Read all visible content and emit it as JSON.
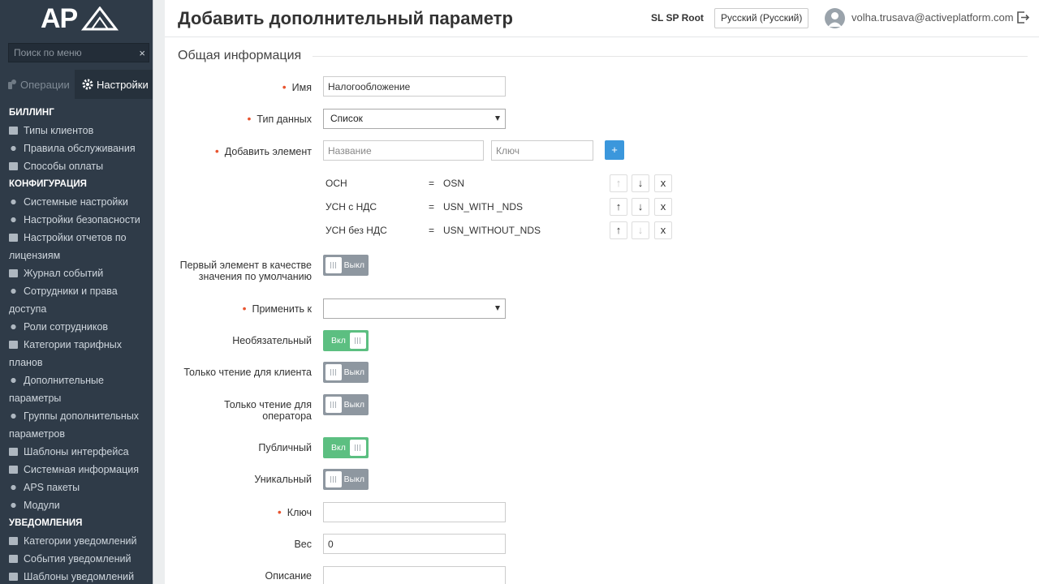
{
  "brand": {
    "logo_text": "AP"
  },
  "sidebar": {
    "search_placeholder": "Поиск по меню",
    "search_clear": "×",
    "tabs": [
      {
        "label": "Операции",
        "icon": "wrench-icon"
      },
      {
        "label": "Настройки",
        "icon": "gear-icon"
      }
    ],
    "sections": [
      {
        "label": "БИЛЛИНГ",
        "items": [
          {
            "label": "Типы клиентов",
            "icon": "list-icon"
          },
          {
            "label": "Правила обслуживания",
            "icon": "user-icon"
          },
          {
            "label": "Способы оплаты",
            "icon": "card-icon"
          }
        ]
      },
      {
        "label": "КОНФИГУРАЦИЯ",
        "items": [
          {
            "label": "Системные настройки",
            "icon": "gear-icon"
          },
          {
            "label": "Настройки безопасности",
            "icon": "shield-icon"
          },
          {
            "label": "Настройки отчетов по лицензиям",
            "icon": "document-icon"
          },
          {
            "label": "Журнал событий",
            "icon": "books-icon"
          },
          {
            "label": "Сотрудники и права доступа",
            "icon": "org-icon"
          },
          {
            "label": "Роли сотрудников",
            "icon": "users-icon"
          },
          {
            "label": "Категории тарифных планов",
            "icon": "folder-icon"
          },
          {
            "label": "Дополнительные параметры",
            "icon": "target-icon"
          },
          {
            "label": "Группы дополнительных параметров",
            "icon": "target-icon"
          },
          {
            "label": "Шаблоны интерфейса",
            "icon": "template-icon"
          },
          {
            "label": "Системная информация",
            "icon": "monitor-icon"
          },
          {
            "label": "APS пакеты",
            "icon": "cubes-icon"
          },
          {
            "label": "Модули",
            "icon": "puzzle-icon"
          }
        ]
      },
      {
        "label": "УВЕДОМЛЕНИЯ",
        "items": [
          {
            "label": "Категории уведомлений",
            "icon": "list-icon"
          },
          {
            "label": "События уведомлений",
            "icon": "calendar-icon"
          },
          {
            "label": "Шаблоны уведомлений",
            "icon": "envelope-icon"
          }
        ]
      }
    ]
  },
  "header": {
    "title": "Добавить дополнительный параметр",
    "account": "SL SP Root",
    "language": "Русский (Русский)",
    "user_email": "volha.trusava@activeplatform.com"
  },
  "form": {
    "section_title": "Общая информация",
    "name": {
      "label": "Имя",
      "value": "Налогообложение"
    },
    "data_type": {
      "label": "Тип данных",
      "value": "Список"
    },
    "add_element": {
      "label": "Добавить элемент",
      "name_placeholder": "Название",
      "key_placeholder": "Ключ",
      "add_label": "+"
    },
    "elements": [
      {
        "name": "ОСН",
        "eq": "=",
        "key": "OSN",
        "up": "↑",
        "down": "↓",
        "remove": "x",
        "up_enabled": false,
        "down_enabled": true
      },
      {
        "name": "УСН с НДС",
        "eq": "=",
        "key": "USN_WITH _NDS",
        "up": "↑",
        "down": "↓",
        "remove": "x",
        "up_enabled": true,
        "down_enabled": true
      },
      {
        "name": "УСН без НДС",
        "eq": "=",
        "key": "USN_WITHOUT_NDS",
        "up": "↑",
        "down": "↓",
        "remove": "x",
        "up_enabled": true,
        "down_enabled": false
      }
    ],
    "first_default": {
      "label_1": "Первый элемент в качестве",
      "label_2": "значения по умолчанию",
      "state": "Выкл",
      "on": false
    },
    "apply_to": {
      "label": "Применить к",
      "value": ""
    },
    "optional": {
      "label": "Необязательный",
      "state": "Вкл",
      "on": true
    },
    "readonly_client": {
      "label": "Только чтение для клиента",
      "state": "Выкл",
      "on": false
    },
    "readonly_operator": {
      "label_1": "Только чтение для",
      "label_2": "оператора",
      "state": "Выкл",
      "on": false
    },
    "public": {
      "label": "Публичный",
      "state": "Вкл",
      "on": true
    },
    "unique": {
      "label": "Уникальный",
      "state": "Выкл",
      "on": false
    },
    "key": {
      "label": "Ключ",
      "value": ""
    },
    "weight": {
      "label": "Вес",
      "value": "0"
    },
    "description": {
      "label": "Описание",
      "value": ""
    }
  },
  "colors": {
    "sidebar_bg": "#2f3b48",
    "accent_blue": "#3b97dc",
    "toggle_on": "#5cbf81",
    "toggle_off": "#8e97a0",
    "required": "#e8542f"
  }
}
